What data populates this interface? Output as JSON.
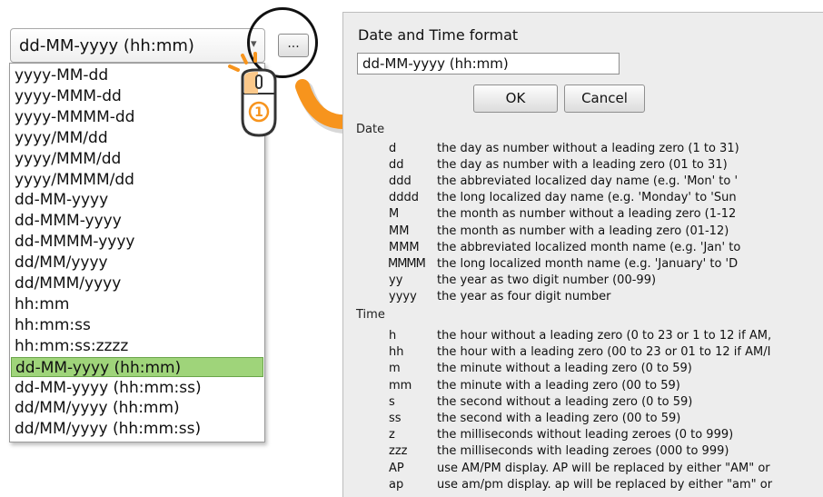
{
  "combo": {
    "value": "dd-MM-yyyy (hh:mm)",
    "arrow": "▾",
    "options": [
      "yyyy-MM-dd",
      "yyyy-MMM-dd",
      "yyyy-MMMM-dd",
      "yyyy/MM/dd",
      "yyyy/MMM/dd",
      "yyyy/MMMM/dd",
      "dd-MM-yyyy",
      "dd-MMM-yyyy",
      "dd-MMMM-yyyy",
      "dd/MM/yyyy",
      "dd/MMM/yyyy",
      "hh:mm",
      "hh:mm:ss",
      "hh:mm:ss:zzzz",
      "dd-MM-yyyy (hh:mm)",
      "dd-MM-yyyy (hh:mm:ss)",
      "dd/MM/yyyy (hh:mm)",
      "dd/MM/yyyy (hh:mm:ss)"
    ],
    "selected": "dd-MM-yyyy (hh:mm)"
  },
  "ellipsis_button": {
    "label": "..."
  },
  "annotation": {
    "step": "1",
    "accent": "#f7941d"
  },
  "dialog": {
    "title": "Date and Time format",
    "input_value": "dd-MM-yyyy (hh:mm)",
    "ok_label": "OK",
    "cancel_label": "Cancel",
    "date_heading": "Date",
    "time_heading": "Time",
    "date_rows": [
      {
        "code": "d",
        "desc": "the day as number without a leading zero (1 to 31)"
      },
      {
        "code": "dd",
        "desc": "the day as number with a leading zero (01 to 31)"
      },
      {
        "code": "ddd",
        "desc": "the abbreviated localized day name (e.g. 'Mon' to '"
      },
      {
        "code": "dddd",
        "desc": "the long localized day name (e.g. 'Monday' to 'Sun"
      },
      {
        "code": "M",
        "desc": "the month as number without a leading zero (1-12"
      },
      {
        "code": "MM",
        "desc": "the month as number with a leading zero (01-12)"
      },
      {
        "code": "MMM",
        "desc": "the abbreviated localized month name (e.g. 'Jan' to"
      },
      {
        "code": "MMMM",
        "desc": "the long localized month name (e.g. 'January' to 'D"
      },
      {
        "code": "yy",
        "desc": "the year as two digit number (00-99)"
      },
      {
        "code": "yyyy",
        "desc": "the year as four digit number"
      }
    ],
    "time_rows": [
      {
        "code": "h",
        "desc": "the hour without a leading zero (0 to 23 or 1 to 12 if AM,"
      },
      {
        "code": "hh",
        "desc": "the hour with a leading zero (00 to 23 or 01 to 12 if AM/I"
      },
      {
        "code": "m",
        "desc": "the minute without a leading zero (0 to 59)"
      },
      {
        "code": "mm",
        "desc": "the minute with a leading zero (00 to 59)"
      },
      {
        "code": "s",
        "desc": "the second without a leading zero (0 to 59)"
      },
      {
        "code": "ss",
        "desc": "the second with a leading zero (00 to 59)"
      },
      {
        "code": "z",
        "desc": "the milliseconds without leading zeroes (0 to 999)"
      },
      {
        "code": "zzz",
        "desc": "the milliseconds with leading zeroes (000 to 999)"
      },
      {
        "code": "AP",
        "desc": "use AM/PM display. AP will be replaced by either \"AM\" or"
      },
      {
        "code": "ap",
        "desc": "use am/pm display. ap will be replaced by either \"am\" or"
      }
    ]
  }
}
